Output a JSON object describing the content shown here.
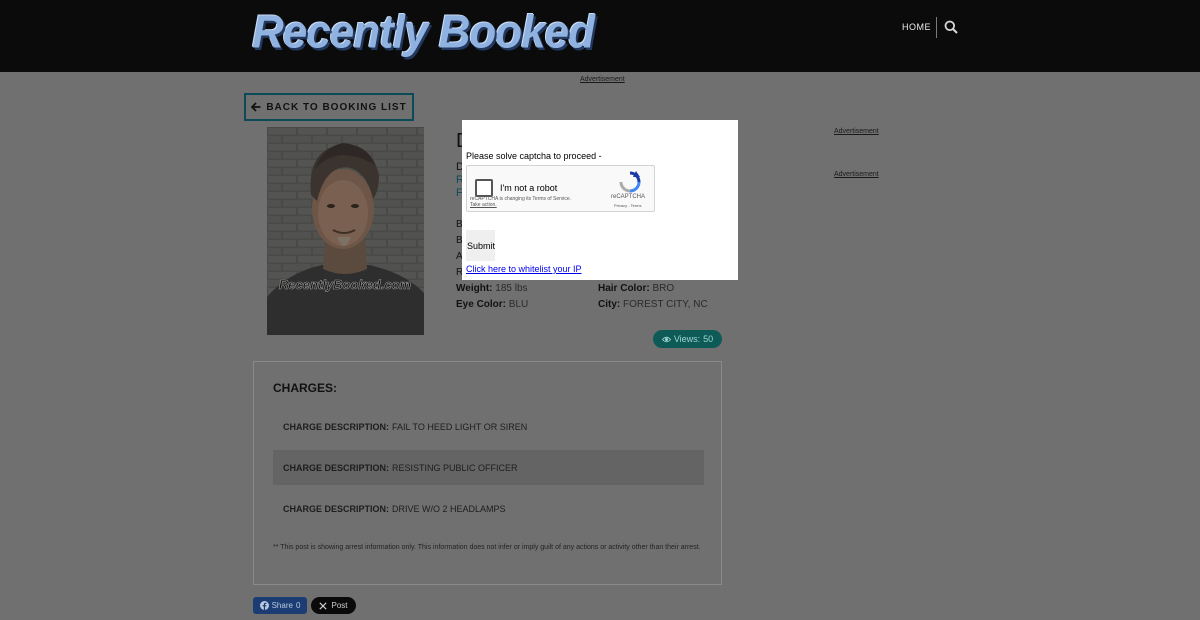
{
  "header": {
    "logo_text": "Recently Booked",
    "nav_home": "HOME",
    "search_icon": "search-icon"
  },
  "ads": {
    "top_label": "Advertisement",
    "side_label_1": "Advertisement",
    "side_label_2": "Advertisement"
  },
  "back_button": {
    "label": "BACK TO BOOKING LIST",
    "icon": "arrow-left-icon"
  },
  "mugshot": {
    "watermark": "RecentlyBooked.com"
  },
  "profile": {
    "partial_letters": [
      "D",
      "D",
      "R",
      "F"
    ],
    "partial_labels": [
      "B",
      "B",
      "A",
      "R"
    ],
    "fields": [
      {
        "label": "Weight:",
        "value": "185 lbs"
      },
      {
        "label": "Hair Color:",
        "value": "BRO"
      },
      {
        "label": "Eye Color:",
        "value": "BLU"
      },
      {
        "label": "City:",
        "value": "FOREST CITY, NC"
      }
    ],
    "views_label": "Views:",
    "views_count": "50"
  },
  "charges": {
    "title": "CHARGES:",
    "label": "CHARGE DESCRIPTION:",
    "items": [
      "FAIL TO HEED LIGHT OR SIREN",
      "RESISTING PUBLIC OFFICER",
      "DRIVE W/O 2 HEADLAMPS"
    ],
    "disclaimer": "** This post is showing arrest information only. This information does not infer or imply guilt of any actions or activity other than their arrest."
  },
  "share": {
    "facebook_label": "Share",
    "facebook_count": "0",
    "x_label": "Post"
  },
  "captcha_modal": {
    "message": "Please solve captcha to proceed -",
    "checkbox_label": "I'm not a robot",
    "notice": "reCAPTCHA is changing its Terms of Service.",
    "notice_action": "Take action.",
    "brand": "reCAPTCHA",
    "terms": "Privacy - Terms",
    "submit_label": "Submit",
    "whitelist_link": "Click here to whitelist your IP"
  },
  "colors": {
    "header_bg": "#0b0b0b",
    "overlay_bg": "#707070",
    "accent_teal": "#0e5a57",
    "back_border": "#0d4a58",
    "link_blue": "#0000ee"
  }
}
